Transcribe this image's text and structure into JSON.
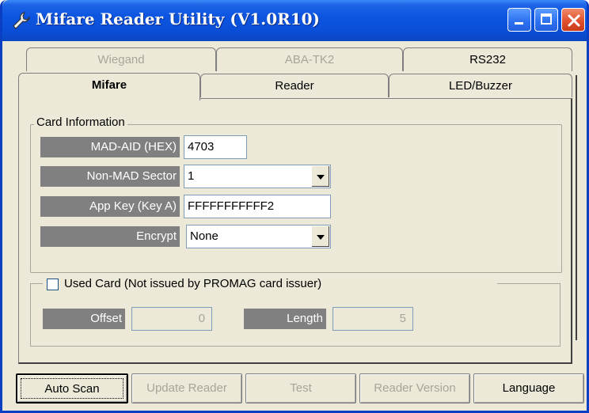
{
  "window": {
    "title": "Mifare Reader Utility (V1.0R10)"
  },
  "tabs_back": [
    {
      "label": "Wiegand",
      "enabled": false
    },
    {
      "label": "ABA-TK2",
      "enabled": false
    },
    {
      "label": "RS232",
      "enabled": true
    }
  ],
  "tabs_front": [
    {
      "label": "Mifare",
      "selected": true
    },
    {
      "label": "Reader",
      "selected": false
    },
    {
      "label": "LED/Buzzer",
      "selected": false
    }
  ],
  "card_info": {
    "title": "Card Information",
    "mad_aid_label": "MAD-AID (HEX)",
    "mad_aid_value": "4703",
    "non_mad_label": "Non-MAD Sector",
    "non_mad_value": "1",
    "app_key_label": "App Key (Key A)",
    "app_key_value": "FFFFFFFFFFF2",
    "encrypt_label": "Encrypt",
    "encrypt_value": "None"
  },
  "used_card": {
    "label": "Used Card (Not issued by PROMAG card issuer)",
    "checked": false,
    "offset_label": "Offset",
    "offset_value": "0",
    "length_label": "Length",
    "length_value": "5"
  },
  "buttons": {
    "auto_scan": "Auto Scan",
    "update_reader": "Update Reader",
    "test": "Test",
    "reader_version": "Reader Version",
    "language": "Language"
  },
  "icons": {
    "app": "wrench-icon",
    "minimize": "minimize-icon",
    "maximize": "maximize-icon",
    "close": "close-icon",
    "dropdown": "chevron-down-icon"
  },
  "colors": {
    "titlebar": "#0A4ED6",
    "window_bg": "#ECE9D8",
    "label_bg": "#808080",
    "close_button": "#E0522E"
  }
}
